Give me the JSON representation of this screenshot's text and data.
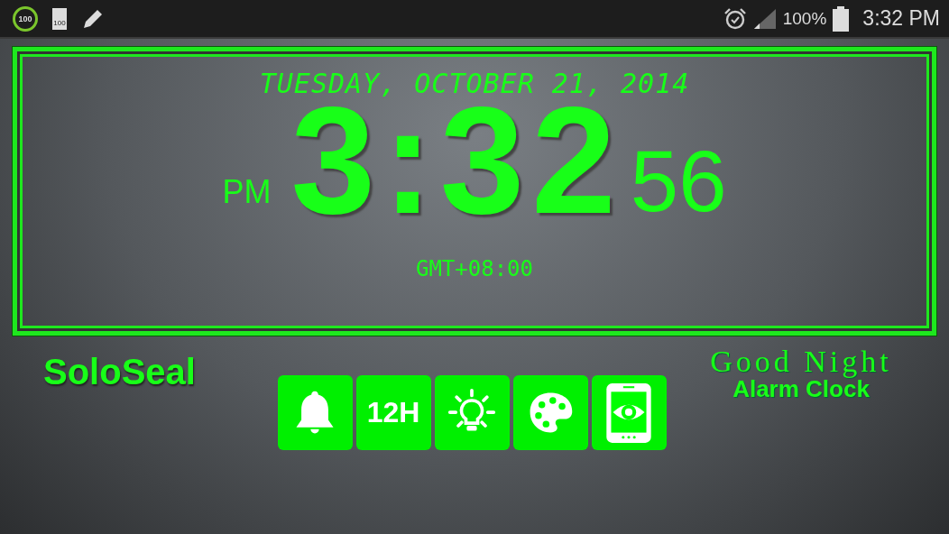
{
  "status_bar": {
    "left_icons": [
      {
        "kind": "ring",
        "text": "100"
      },
      {
        "kind": "battery",
        "text": "100"
      },
      {
        "kind": "pencil"
      }
    ],
    "battery_percent": "100%",
    "time": "3:32 PM"
  },
  "clock": {
    "date": "TUESDAY, OCTOBER 21, 2014",
    "ampm": "PM",
    "time": "3:32",
    "seconds": "56",
    "timezone": "GMT+08:00"
  },
  "brand": "SoloSeal",
  "buttons": [
    {
      "kind": "bell"
    },
    {
      "kind": "text",
      "label": "12H"
    },
    {
      "kind": "bulb"
    },
    {
      "kind": "palette"
    },
    {
      "kind": "tablet"
    }
  ],
  "logo": {
    "line1": "Good Night",
    "line2": "Alarm Clock"
  }
}
